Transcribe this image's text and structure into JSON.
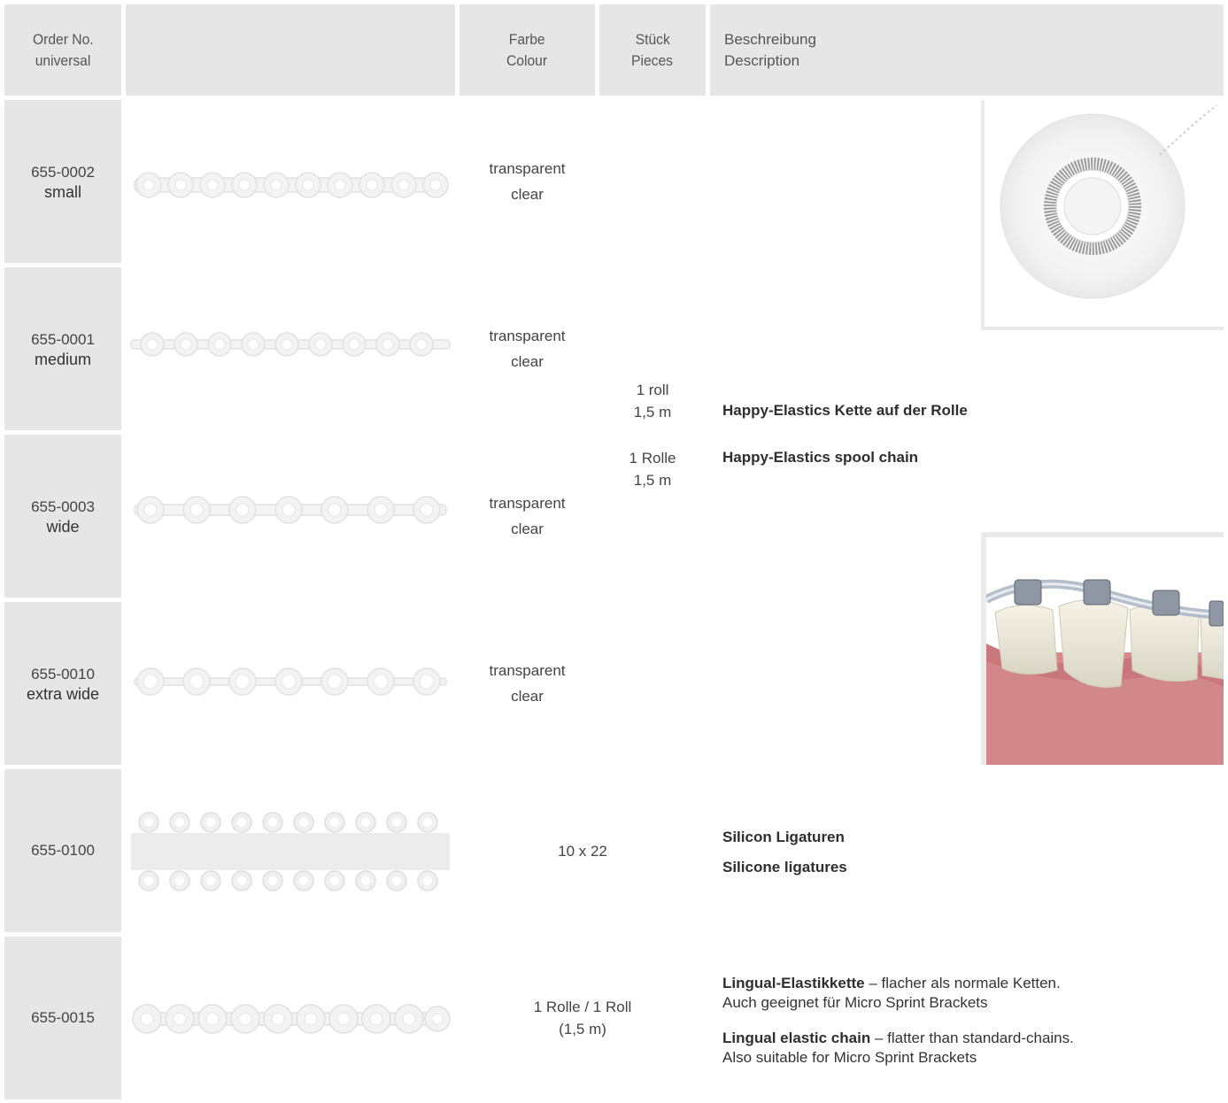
{
  "header": {
    "order_line1": "Order No.",
    "order_line2": "universal",
    "colour_line1": "Farbe",
    "colour_line2": "Colour",
    "pieces_line1": "Stück",
    "pieces_line2": "Pieces",
    "desc_line1": "Beschreibung",
    "desc_line2": "Description"
  },
  "rows": [
    {
      "order": "655-0002",
      "size": "small",
      "colour_de": "transparent",
      "colour_en": "clear"
    },
    {
      "order": "655-0001",
      "size": "medium",
      "colour_de": "transparent",
      "colour_en": "clear"
    },
    {
      "order": "655-0003",
      "size": "wide",
      "colour_de": "transparent",
      "colour_en": "clear"
    },
    {
      "order": "655-0010",
      "size": "extra wide",
      "colour_de": "transparent",
      "colour_en": "clear"
    },
    {
      "order": "655-0100",
      "pieces": "10 x 22"
    },
    {
      "order": "655-0015",
      "pieces_line1": "1 Rolle / 1 Roll",
      "pieces_line2": "(1,5 m)"
    }
  ],
  "spool": {
    "pieces_en_1": "1 roll",
    "pieces_en_2": "1,5 m",
    "pieces_de_1": "1 Rolle",
    "pieces_de_2": "1,5 m",
    "desc_de": "Happy-Elastics Kette auf der Rolle",
    "desc_en": "Happy-Elastics spool chain"
  },
  "ligatures": {
    "desc_de": "Silicon Ligaturen",
    "desc_en": "Silicone ligatures"
  },
  "lingual": {
    "de_bold": "Lingual-Elastikkette",
    "de_rest": " – flacher als normale Ketten.",
    "de_line2": "Auch geeignet für Micro Sprint Brackets",
    "en_bold": "Lingual elastic chain",
    "en_rest": " – flatter than standard-chains.",
    "en_line2": "Also suitable for Micro Sprint Brackets"
  }
}
